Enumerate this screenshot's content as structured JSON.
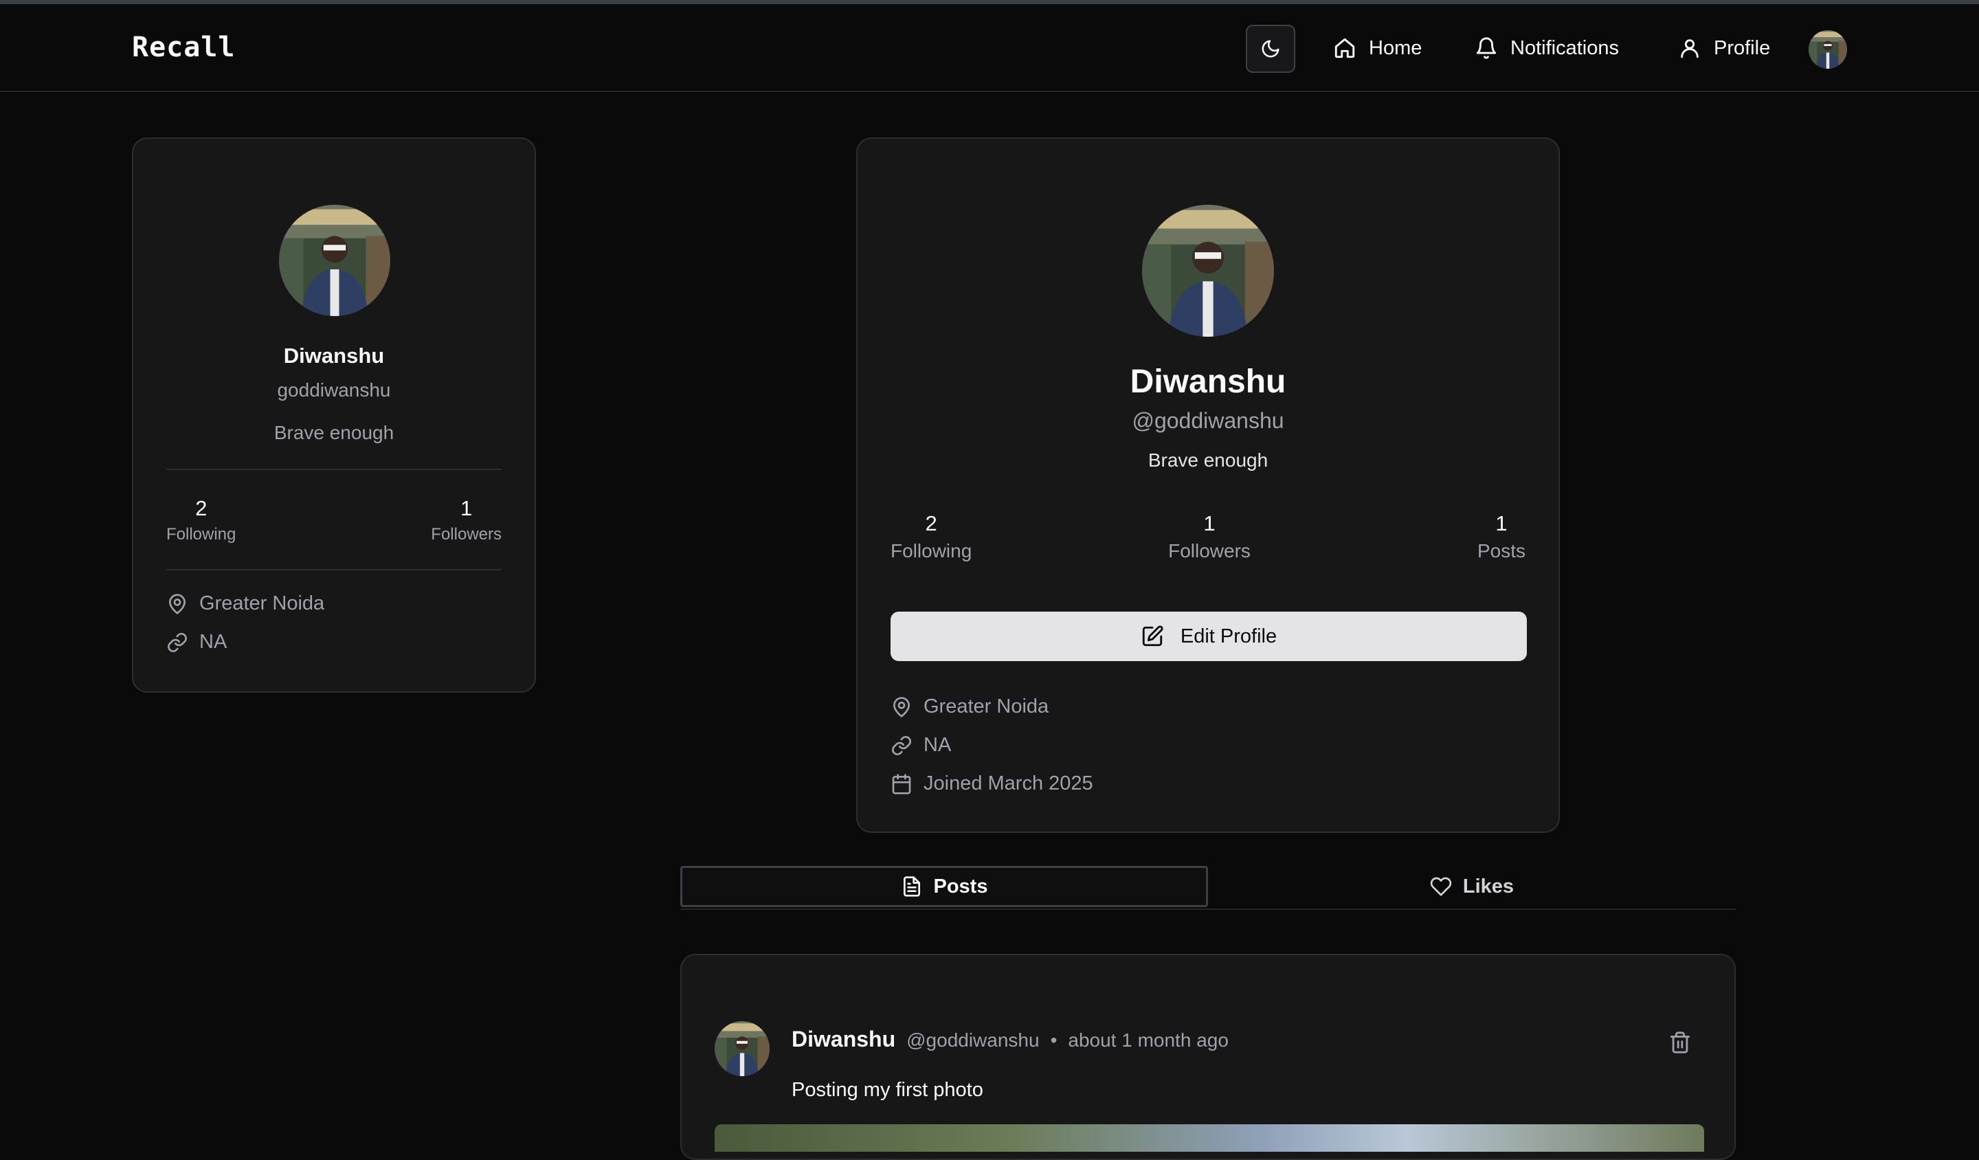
{
  "app": {
    "brand": "Recall"
  },
  "nav": {
    "home": "Home",
    "notifications": "Notifications",
    "profile": "Profile"
  },
  "user": {
    "name": "Diwanshu",
    "username": "goddiwanshu",
    "handle": "@goddiwanshu",
    "bio": "Brave enough",
    "following_count": "2",
    "following_label": "Following",
    "followers_count": "1",
    "followers_label": "Followers",
    "posts_count": "1",
    "posts_label": "Posts",
    "location": "Greater Noida",
    "website": "NA",
    "joined": "Joined March 2025"
  },
  "profile_card": {
    "edit_label": "Edit Profile"
  },
  "tabs": {
    "posts": "Posts",
    "likes": "Likes"
  },
  "post": {
    "author": "Diwanshu",
    "handle": "@goddiwanshu",
    "separator": "•",
    "time": "about 1 month ago",
    "content": "Posting my first photo"
  },
  "icons": {
    "theme": "moon-icon",
    "home": "home-icon",
    "notifications": "bell-icon",
    "profile": "user-icon",
    "location": "map-pin-icon",
    "link": "link-icon",
    "calendar": "calendar-icon",
    "edit": "edit-icon",
    "posts": "file-text-icon",
    "likes": "heart-icon",
    "delete": "trash-icon"
  }
}
